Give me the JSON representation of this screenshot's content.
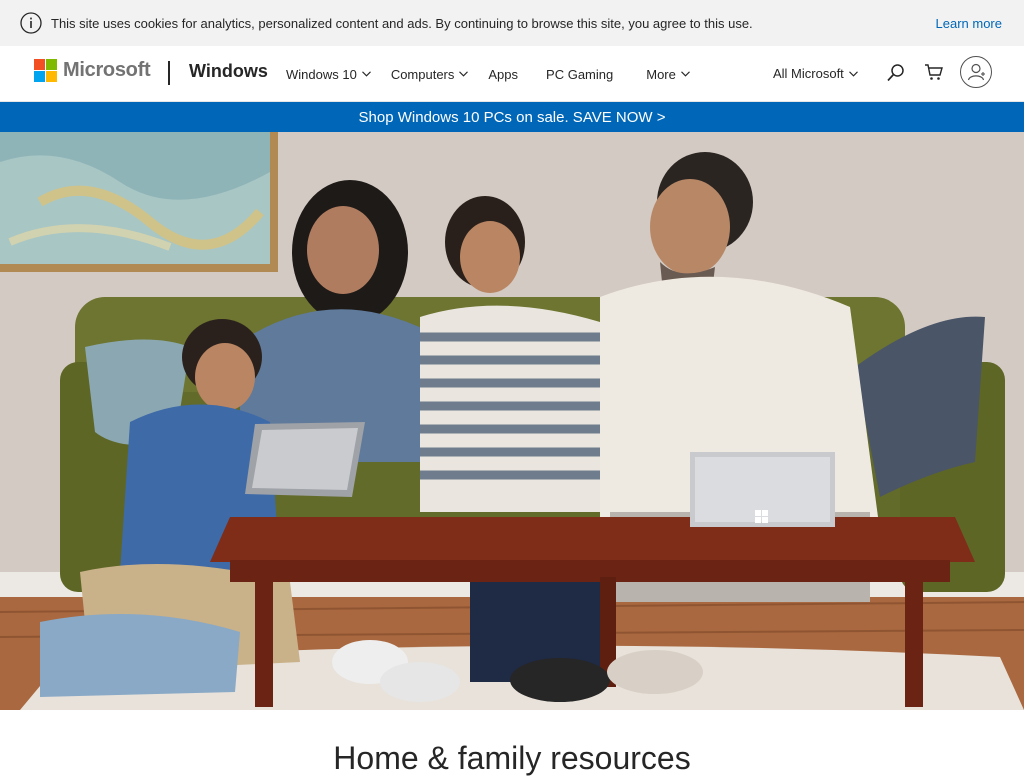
{
  "cookie_bar": {
    "icon": "info-icon",
    "text": "This site uses cookies for analytics, personalized content and ads. By continuing to browse this site, you agree to this use.",
    "learn_more": "Learn more"
  },
  "header": {
    "brand": "Microsoft",
    "product": "Windows",
    "nav": [
      {
        "label": "Windows 10",
        "has_dropdown": true
      },
      {
        "label": "Computers",
        "has_dropdown": true
      },
      {
        "label": "Apps",
        "has_dropdown": false
      },
      {
        "label": "PC Gaming",
        "has_dropdown": false
      },
      {
        "label": "More",
        "has_dropdown": true
      }
    ],
    "all_microsoft": "All Microsoft",
    "icons": {
      "search": "search-icon",
      "cart": "cart-icon",
      "account": "account-icon"
    }
  },
  "promo": {
    "text": "Shop Windows 10 PCs on sale. SAVE NOW >"
  },
  "hero": {
    "image": "family-on-couch-with-surface-devices-photo"
  },
  "section": {
    "heading": "Home & family resources"
  },
  "colors": {
    "accent": "#0067b8",
    "logo_red": "#f25022",
    "logo_green": "#7fba00",
    "logo_blue": "#00a4ef",
    "logo_yellow": "#ffb900"
  }
}
